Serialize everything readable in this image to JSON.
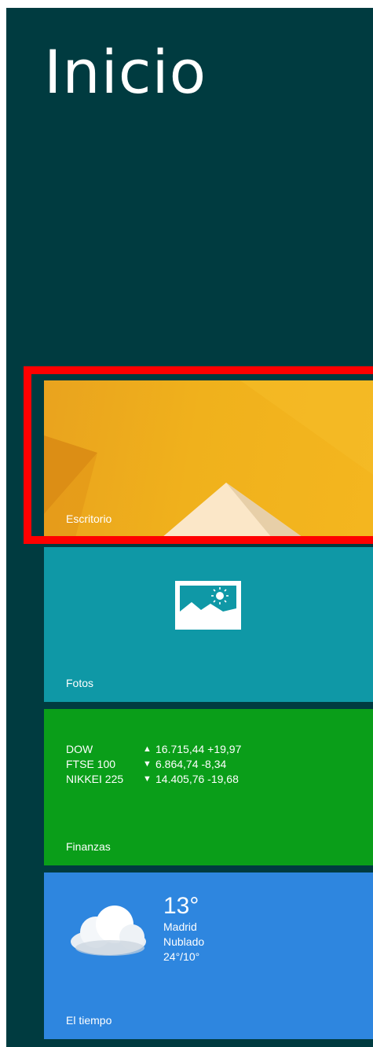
{
  "start": {
    "title": "Inicio"
  },
  "tiles": {
    "desktop": {
      "label": "Escritorio",
      "color": "#f0b11c"
    },
    "photos": {
      "label": "Fotos",
      "icon": "photo-landscape-icon",
      "color": "#0f98a6"
    },
    "finance": {
      "label": "Finanzas",
      "color": "#0a9e19",
      "tickers": [
        {
          "name": "DOW",
          "direction": "up",
          "arrow": "▲",
          "value": "16.715,44 +19,97"
        },
        {
          "name": "FTSE 100",
          "direction": "down",
          "arrow": "▼",
          "value": "6.864,74 -8,34"
        },
        {
          "name": "NIKKEI 225",
          "direction": "down",
          "arrow": "▼",
          "value": "14.405,76 -19,68"
        }
      ]
    },
    "weather": {
      "label": "El tiempo",
      "icon": "cloud-icon",
      "color": "#2e86df",
      "temperature": "13°",
      "city": "Madrid",
      "condition": "Nublado",
      "high_low": "24°/10°"
    }
  },
  "highlight": {
    "color": "#ff0000",
    "target": "desktop"
  }
}
